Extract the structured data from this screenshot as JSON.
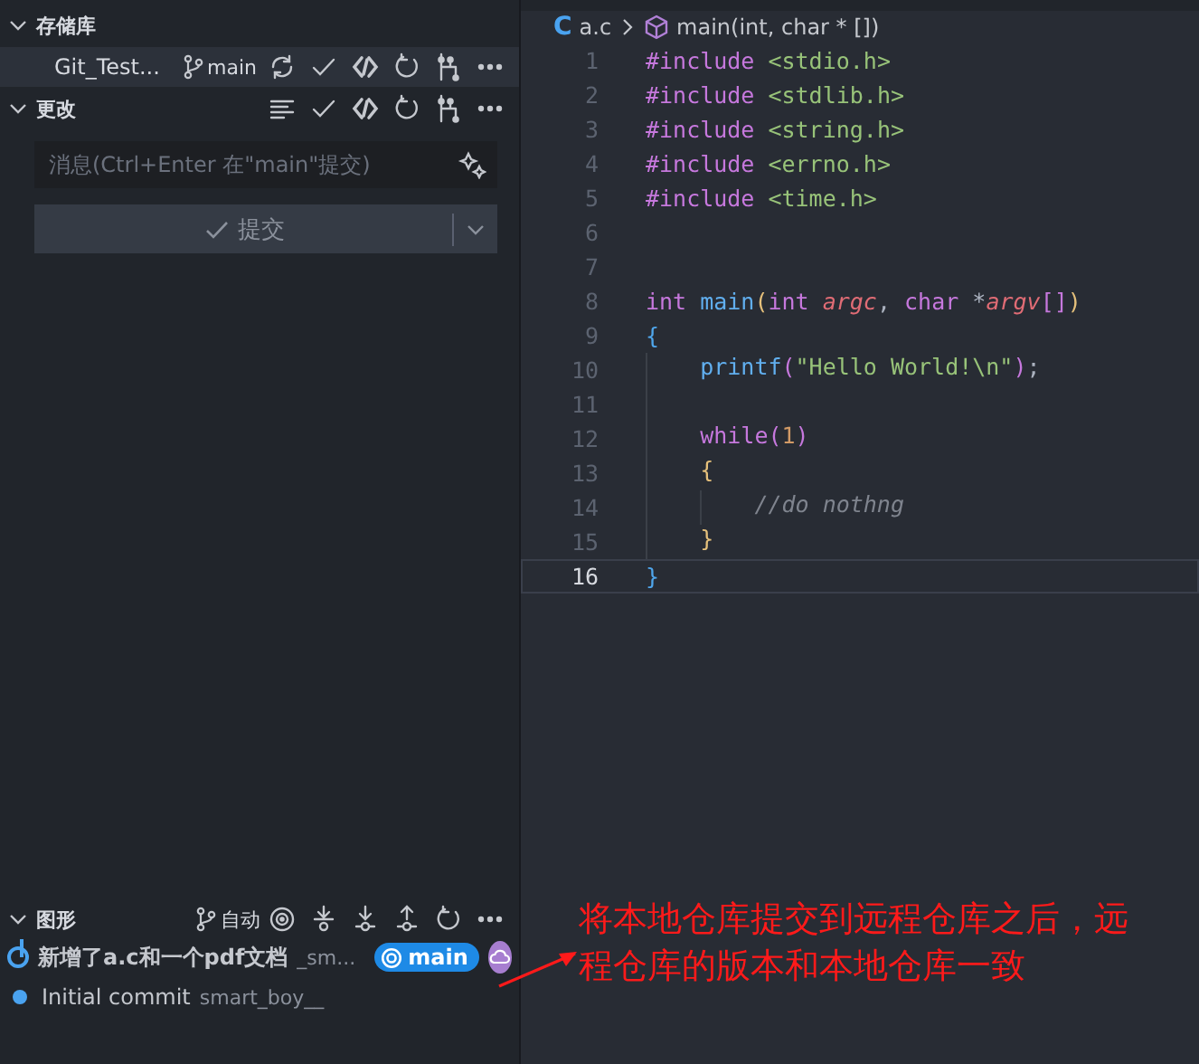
{
  "scm": {
    "repositories": {
      "title": "存储库",
      "expanded": true,
      "repo": {
        "name": "Git_Test...",
        "branch": "main"
      }
    },
    "changes": {
      "title": "更改",
      "expanded": true,
      "message": {
        "placeholder": "消息(Ctrl+Enter 在\"main\"提交)"
      },
      "commit_button": "提交"
    },
    "graph": {
      "title": "图形",
      "expanded": true,
      "mode": "自动",
      "commits": [
        {
          "message": "新增了a.c和一个pdf文档",
          "author": "_sm...",
          "head": true,
          "branch": "main"
        },
        {
          "message": "Initial commit",
          "author": "smart_boy__",
          "head": false
        }
      ]
    }
  },
  "editor": {
    "breadcrumb": {
      "file_icon": "C",
      "file": "a.c",
      "symbol": "main(int, char * [])"
    },
    "lines": [
      {
        "number": "1",
        "current": false,
        "tokens": [
          {
            "text": "#include ",
            "kind": "keyword"
          },
          {
            "text": "<stdio.h>",
            "kind": "string"
          }
        ]
      },
      {
        "number": "2",
        "current": false,
        "tokens": [
          {
            "text": "#include ",
            "kind": "keyword"
          },
          {
            "text": "<stdlib.h>",
            "kind": "string"
          }
        ]
      },
      {
        "number": "3",
        "current": false,
        "tokens": [
          {
            "text": "#include ",
            "kind": "keyword"
          },
          {
            "text": "<string.h>",
            "kind": "string"
          }
        ]
      },
      {
        "number": "4",
        "current": false,
        "tokens": [
          {
            "text": "#include ",
            "kind": "keyword"
          },
          {
            "text": "<errno.h>",
            "kind": "string"
          }
        ]
      },
      {
        "number": "5",
        "current": false,
        "tokens": [
          {
            "text": "#include ",
            "kind": "keyword"
          },
          {
            "text": "<time.h>",
            "kind": "string"
          }
        ]
      },
      {
        "number": "6",
        "current": false
      },
      {
        "number": "7",
        "current": false
      },
      {
        "number": "8",
        "current": false,
        "tokens": [
          {
            "text": "int ",
            "kind": "keyword"
          },
          {
            "text": "main",
            "kind": "function"
          },
          {
            "text": "(",
            "kind": "bracket1"
          },
          {
            "text": "int ",
            "kind": "keyword"
          },
          {
            "text": "argc",
            "kind": "param"
          },
          {
            "text": ", ",
            "kind": "plain"
          },
          {
            "text": "char ",
            "kind": "keyword"
          },
          {
            "text": "*",
            "kind": "plain"
          },
          {
            "text": "argv",
            "kind": "param"
          },
          {
            "text": "[]",
            "kind": "bracket2"
          },
          {
            "text": ")",
            "kind": "bracket1"
          }
        ]
      },
      {
        "number": "9",
        "current": false,
        "tokens": [
          {
            "text": "{",
            "kind": "bracket3"
          }
        ],
        "children": [
          {
            "number": "10",
            "current": false,
            "tokens": [
              {
                "text": "printf",
                "kind": "function"
              },
              {
                "text": "(",
                "kind": "bracket2"
              },
              {
                "text": "\"Hello World!\\n\"",
                "kind": "string"
              },
              {
                "text": ")",
                "kind": "bracket2"
              },
              {
                "text": ";",
                "kind": "plain"
              }
            ]
          },
          {
            "number": "11",
            "current": false
          },
          {
            "number": "12",
            "current": false,
            "tokens": [
              {
                "text": "while",
                "kind": "keyword"
              },
              {
                "text": "(",
                "kind": "bracket2"
              },
              {
                "text": "1",
                "kind": "number"
              },
              {
                "text": ")",
                "kind": "bracket2"
              }
            ]
          },
          {
            "number": "13",
            "current": false,
            "tokens": [
              {
                "text": "{",
                "kind": "bracket1"
              }
            ],
            "children": [
              {
                "number": "14",
                "current": false,
                "tokens": [
                  {
                    "text": "//do nothng",
                    "kind": "comment"
                  }
                ]
              }
            ]
          },
          {
            "number": "15",
            "current": false,
            "tokens": [
              {
                "text": "}",
                "kind": "bracket1"
              }
            ]
          }
        ]
      },
      {
        "number": "16",
        "current": true,
        "tokens": [
          {
            "text": "}",
            "kind": "bracket3"
          }
        ]
      }
    ]
  },
  "annotation": {
    "lines": [
      "将本地仓库提交到远程仓库之后，远",
      "程仓库的版本和本地仓库一致"
    ]
  }
}
